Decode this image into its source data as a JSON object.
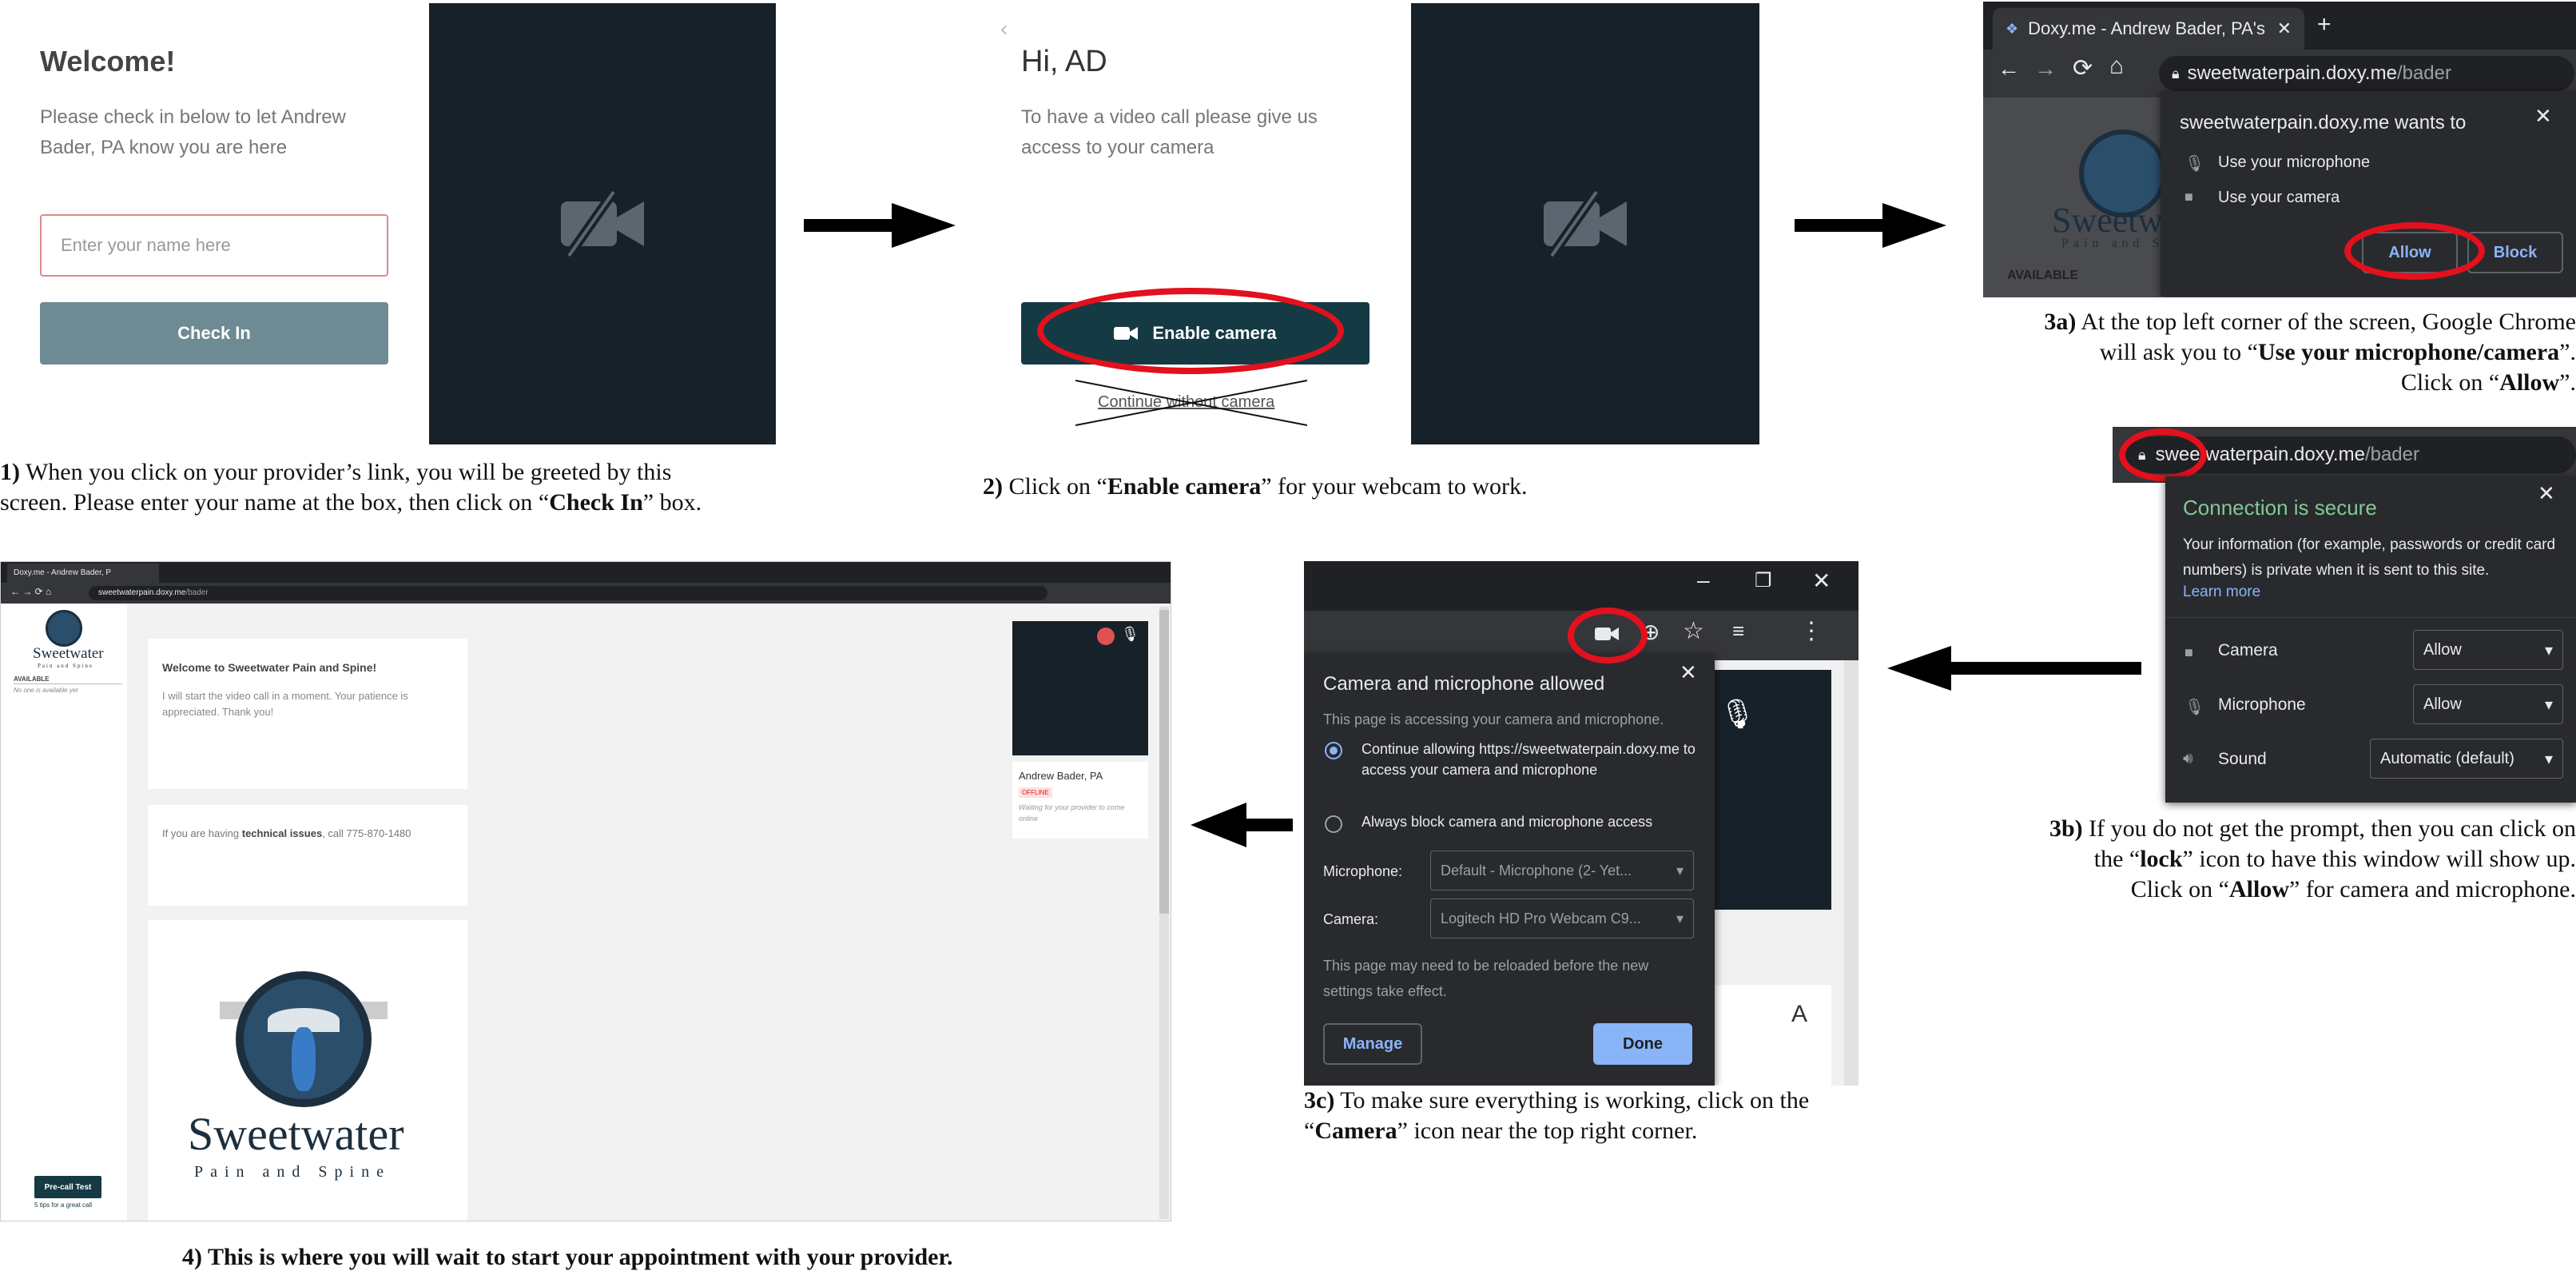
{
  "step1": {
    "heading": "Welcome!",
    "message": "Please check in below to let Andrew Bader, PA know you are here",
    "name_placeholder": "Enter your name here",
    "checkin_label": "Check In",
    "caption_num": "1)",
    "caption_a": " When you click on your provider’s link, you will be greeted by this",
    "caption_b": "screen. Please enter your name at the box, then click on “",
    "caption_bold": "Check In",
    "caption_c": "” box."
  },
  "step2": {
    "heading": "Hi, AD",
    "message": "To have a video call please give us access to your camera",
    "enable_label": "Enable camera",
    "continue_label": "Continue without camera",
    "caption_num": "2)",
    "caption_a": " Click on “",
    "caption_bold": "Enable camera",
    "caption_c": "” for your webcam to work."
  },
  "step3a": {
    "tab_title": "Doxy.me - Andrew Bader, PA's W",
    "url_host": "sweetwaterpain.doxy.me",
    "url_path": "/bader",
    "prompt_title": "sweetwaterpain.doxy.me wants to",
    "perm_mic": "Use your microphone",
    "perm_cam": "Use your camera",
    "allow": "Allow",
    "block": "Block",
    "logo_word": "Sweetwat",
    "logo_sub": "Pain and Sp",
    "available": "AVAILABLE",
    "cap_num": "3a)",
    "cap_a": " At the top left corner of the screen,  Google Chrome",
    "cap_b": "will ask you to “",
    "cap_bold": "Use your microphone/camera",
    "cap_c": "”.",
    "cap_d": "Click on “",
    "cap_bold2": "Allow",
    "cap_e": "”."
  },
  "step3b": {
    "url_host": "sweetwaterpain.doxy.me",
    "url_path": "/bader",
    "title": "Connection is secure",
    "info": "Your information (for example, passwords or credit card numbers) is private when it is sent to this site.",
    "learn_more": "Learn more",
    "camera": "Camera",
    "camera_value": "Allow",
    "microphone": "Microphone",
    "microphone_value": "Allow",
    "sound": "Sound",
    "sound_value": "Automatic (default)",
    "cap_num": "3b)",
    "cap_a": " If you do not get the prompt, then you can click on",
    "cap_b": "the “",
    "cap_bold": "lock",
    "cap_c": "” icon to have this window will show up.",
    "cap_d": "Click on “",
    "cap_bold2": "Allow",
    "cap_e": "” for camera and microphone."
  },
  "step3c": {
    "title": "Camera and microphone allowed",
    "desc": "This page is accessing your camera and microphone.",
    "opt1": "Continue allowing https://sweetwaterpain.doxy.me to access your camera and microphone",
    "opt2": "Always block camera and microphone access",
    "mic_label": "Microphone:",
    "mic_value": "Default - Microphone (2- Yet...",
    "cam_label": "Camera:",
    "cam_value": "Logitech HD Pro Webcam C9...",
    "reload_note": "This page may need to be reloaded before the new settings take effect.",
    "manage": "Manage",
    "done": "Done",
    "behind_letter": "A",
    "cap_num": "3c)",
    "cap_a": " To make sure everything is working, click on the",
    "cap_b": "“",
    "cap_bold": "Camera",
    "cap_c": "” icon near the top right corner."
  },
  "step4": {
    "tab_title": "Doxy.me - Andrew Bader, P",
    "url_host": "sweetwaterpain.doxy.me",
    "url_path": "/bader",
    "logo_word": "Sweetwater",
    "logo_sub": "Pain and Spine",
    "available": "AVAILABLE",
    "no_one": "No one is available yet",
    "welcome": "Welcome to Sweetwater Pain and Spine!",
    "welcome_msg": "I will start the video call in a moment. Your patience is appreciated. Thank you!",
    "tech_a": "If you are having ",
    "tech_bold": "technical issues",
    "tech_b": ", call 775-870-1480",
    "big_logo_word": "Sweetwater",
    "big_logo_sub": "Pain and Spine",
    "provider": "Andrew Bader, PA",
    "offline": "OFFLINE",
    "waiting": "Waiting for your provider to come online",
    "precall": "Pre-call Test",
    "tips": "5 tips for a great call",
    "caption": "4) This is where you will wait to start your appointment with your provider."
  },
  "colors": {
    "accent_red": "#e3101e",
    "teal_button": "#153a44",
    "chrome_blue": "#8ab4f8",
    "secure_green": "#81c995"
  }
}
